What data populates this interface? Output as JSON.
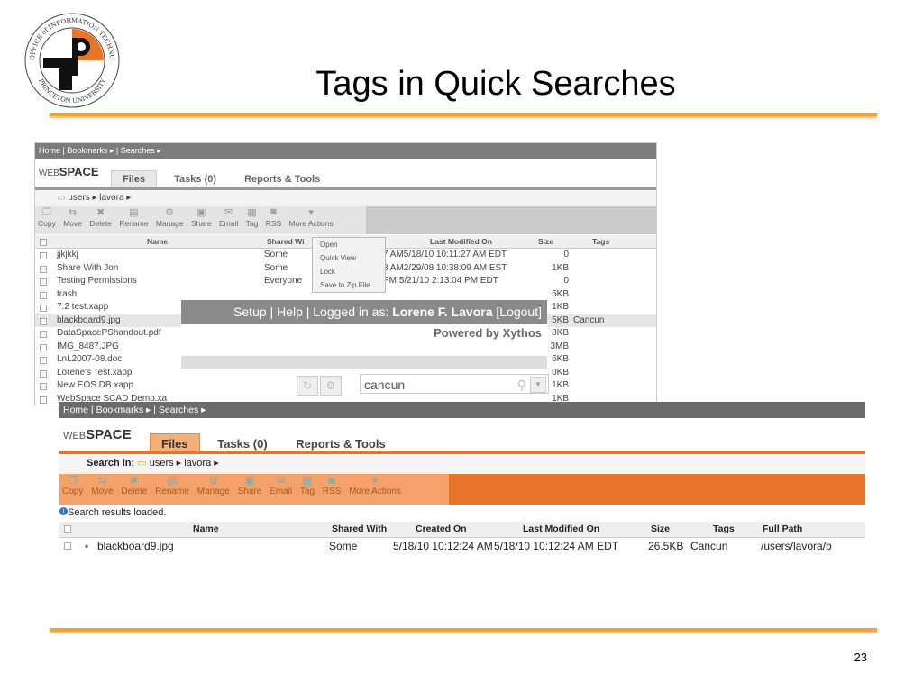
{
  "slide": {
    "title": "Tags in Quick Searches",
    "page_number": "23",
    "logo": {
      "ring_text": "OFFICE of INFORMATION TECHNOLOGY · PRINCETON UNIVERSITY"
    }
  },
  "shot1": {
    "nav": "Home | Bookmarks ▸ | Searches ▸",
    "brand_a": "WEB",
    "brand_b": "SPACE",
    "tabs": [
      "Files",
      "Tasks (0)",
      "Reports & Tools"
    ],
    "breadcrumb": "users ▸ lavora ▸",
    "toolbar": [
      "Copy",
      "Move",
      "Delete",
      "Rename",
      "Manage",
      "Share",
      "Email",
      "Tag",
      "RSS",
      "More Actions"
    ],
    "columns": {
      "name": "Name",
      "shared": "Shared Wi",
      "modified": "Last Modified On",
      "size": "Size",
      "tags": "Tags"
    },
    "context_menu": [
      "Open",
      "Quick View",
      "Lock",
      "Save to Zip File"
    ],
    "rows": [
      {
        "name": "jjkjkkj",
        "shared": "Some",
        "modified": "7 AM5/18/10 10:11:27 AM EDT",
        "size": "0",
        "tags": ""
      },
      {
        "name": "Share With Jon",
        "shared": "Some",
        "modified": "8 AM2/29/08 10:38:09 AM EST",
        "size": "1KB",
        "tags": ""
      },
      {
        "name": "Testing Permissions",
        "shared": "Everyone",
        "modified": "PM 5/21/10 2:13:04 PM EDT",
        "size": "0",
        "tags": ""
      },
      {
        "name": "trash",
        "shared": "",
        "modified": "",
        "size": "5KB",
        "tags": ""
      },
      {
        "name": "7.2 test.xapp",
        "shared": "",
        "modified": "",
        "size": "1KB",
        "tags": ""
      },
      {
        "name": "blackboard9.jpg",
        "shared": "",
        "modified": "",
        "size": "5KB",
        "tags": "Cancun"
      },
      {
        "name": "DataSpacePShandout.pdf",
        "shared": "",
        "modified": "",
        "size": "8KB",
        "tags": ""
      },
      {
        "name": "IMG_8487.JPG",
        "shared": "",
        "modified": "",
        "size": "3MB",
        "tags": ""
      },
      {
        "name": "LnL2007-08.doc",
        "shared": "",
        "modified": "",
        "size": "6KB",
        "tags": ""
      },
      {
        "name": "Lorene's Test.xapp",
        "shared": "",
        "modified": "",
        "size": "0KB",
        "tags": ""
      },
      {
        "name": "New EOS DB.xapp",
        "shared": "",
        "modified": "",
        "size": "1KB",
        "tags": ""
      },
      {
        "name": "WebSpace SCAD Demo.xa",
        "shared": "",
        "modified": "",
        "size": "1KB",
        "tags": ""
      }
    ],
    "footer": "Setup | Help | Logged in as: ",
    "footer_user": "Lorene F. Lavora",
    "footer_logout": " [Logout]",
    "powered": "Powered by Xythos",
    "search_value": "cancun"
  },
  "shot2": {
    "nav": "Home | Bookmarks ▸ | Searches ▸",
    "brand_a": "WEB",
    "brand_b": "SPACE",
    "tabs": [
      "Files",
      "Tasks (0)",
      "Reports & Tools"
    ],
    "search_in_label": "Search in:",
    "breadcrumb": "users ▸ lavora ▸",
    "toolbar": [
      "Copy",
      "Move",
      "Delete",
      "Rename",
      "Manage",
      "Share",
      "Email",
      "Tag",
      "RSS",
      "More Actions"
    ],
    "status": "Search results loaded.",
    "columns": {
      "name": "Name",
      "shared": "Shared With",
      "created": "Created On",
      "modified": "Last Modified On",
      "size": "Size",
      "tags": "Tags",
      "path": "Full Path"
    },
    "row": {
      "name": "blackboard9.jpg",
      "shared": "Some",
      "created": "5/18/10 10:12:24 AM",
      "modified": "5/18/10 10:12:24 AM EDT",
      "size": "26.5KB",
      "tags": "Cancun",
      "path": "/users/lavora/b"
    }
  },
  "colors": {
    "accent_orange": "#e8742a",
    "rule": "#f2a23a"
  }
}
